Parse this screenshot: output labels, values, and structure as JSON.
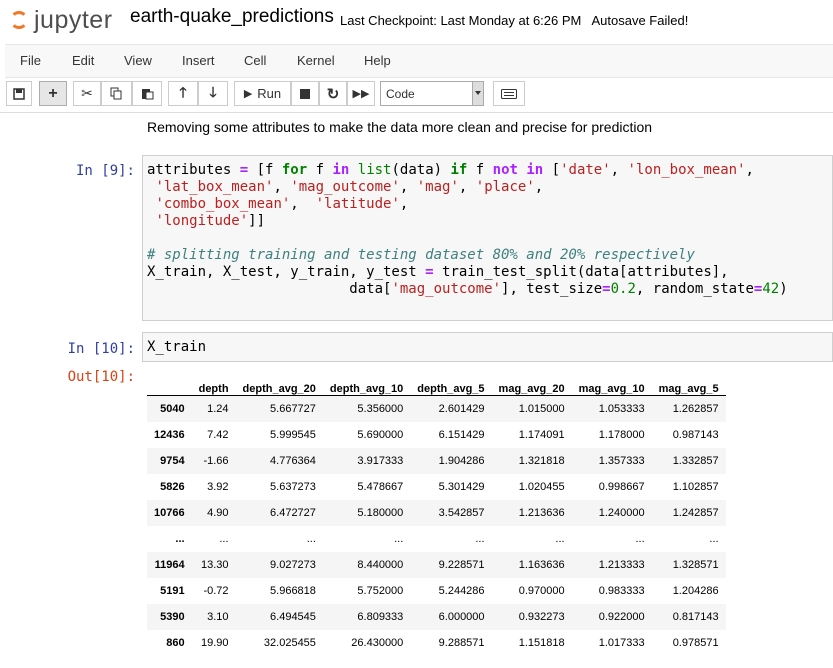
{
  "app": {
    "logo_text": "jupyter",
    "notebook_name": "earth-quake_predictions",
    "checkpoint": "Last Checkpoint: Last Monday at 6:26 PM",
    "autosave": "Autosave Failed!"
  },
  "menu": [
    "File",
    "Edit",
    "View",
    "Insert",
    "Cell",
    "Kernel",
    "Help"
  ],
  "toolbar": {
    "run_label": "Run",
    "cell_type": "Code"
  },
  "markdown_text": "Removing some attributes to make the data more clean and precise for prediction",
  "cells": {
    "in9_prompt": "In [9]:",
    "in10_prompt": "In [10]:",
    "out10_prompt": "Out[10]:",
    "in10_code": "X_train"
  },
  "table": {
    "columns": [
      "",
      "depth",
      "depth_avg_20",
      "depth_avg_10",
      "depth_avg_5",
      "mag_avg_20",
      "mag_avg_10",
      "mag_avg_5"
    ],
    "rows": [
      [
        "5040",
        "1.24",
        "5.667727",
        "5.356000",
        "2.601429",
        "1.015000",
        "1.053333",
        "1.262857"
      ],
      [
        "12436",
        "7.42",
        "5.999545",
        "5.690000",
        "6.151429",
        "1.174091",
        "1.178000",
        "0.987143"
      ],
      [
        "9754",
        "-1.66",
        "4.776364",
        "3.917333",
        "1.904286",
        "1.321818",
        "1.357333",
        "1.332857"
      ],
      [
        "5826",
        "3.92",
        "5.637273",
        "5.478667",
        "5.301429",
        "1.020455",
        "0.998667",
        "1.102857"
      ],
      [
        "10766",
        "4.90",
        "6.472727",
        "5.180000",
        "3.542857",
        "1.213636",
        "1.240000",
        "1.242857"
      ],
      [
        "...",
        "...",
        "...",
        "...",
        "...",
        "...",
        "...",
        "..."
      ],
      [
        "11964",
        "13.30",
        "9.027273",
        "8.440000",
        "9.228571",
        "1.163636",
        "1.213333",
        "1.328571"
      ],
      [
        "5191",
        "-0.72",
        "5.966818",
        "5.752000",
        "5.244286",
        "0.970000",
        "0.983333",
        "1.204286"
      ],
      [
        "5390",
        "3.10",
        "6.494545",
        "6.809333",
        "6.000000",
        "0.932273",
        "0.922000",
        "0.817143"
      ],
      [
        "860",
        "19.90",
        "32.025455",
        "26.430000",
        "9.288571",
        "1.151818",
        "1.017333",
        "0.978571"
      ]
    ]
  }
}
